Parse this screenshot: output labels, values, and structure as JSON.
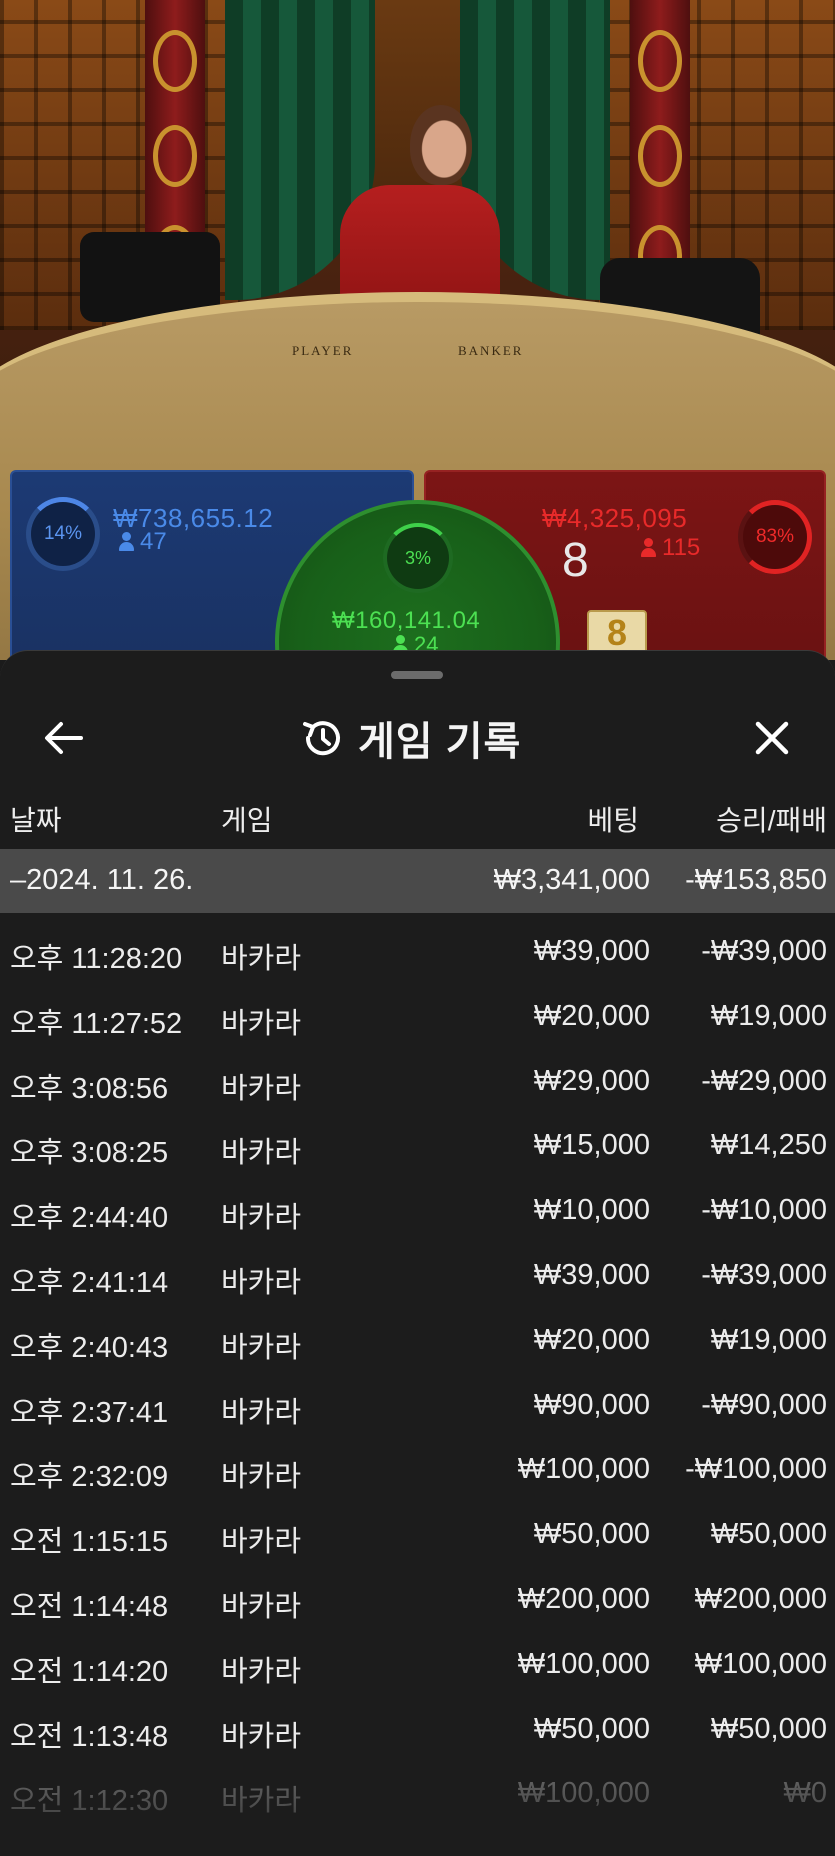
{
  "live_table": {
    "label_player": "PLAYER",
    "label_banker": "BANKER",
    "player": {
      "percent": "14%",
      "amount": "₩738,655.12",
      "bettors": "47"
    },
    "banker": {
      "percent": "83%",
      "amount": "₩4,325,095",
      "bettors": "115",
      "score": "8"
    },
    "tie": {
      "percent": "3%",
      "amount": "₩160,141.04",
      "bettors": "24"
    },
    "card_value": "8",
    "colors": {
      "player": "#4a8ae8",
      "banker": "#e82a2a",
      "tie": "#4ce052"
    }
  },
  "sheet": {
    "title": "게임 기록",
    "title_icon": "history-icon",
    "back_icon": "arrow-left-icon",
    "close_icon": "close-icon"
  },
  "columns": {
    "date": "날짜",
    "game": "게임",
    "bet": "베팅",
    "win_loss": "승리/패배"
  },
  "summary": {
    "date": "–2024. 11. 26.",
    "bet": "₩3,341,000",
    "win_loss": "-₩153,850"
  },
  "rows": [
    {
      "time": "오후 11:28:20",
      "game": "바카라",
      "bet": "₩39,000",
      "win_loss": "-₩39,000"
    },
    {
      "time": "오후 11:27:52",
      "game": "바카라",
      "bet": "₩20,000",
      "win_loss": "₩19,000"
    },
    {
      "time": "오후 3:08:56",
      "game": "바카라",
      "bet": "₩29,000",
      "win_loss": "-₩29,000"
    },
    {
      "time": "오후 3:08:25",
      "game": "바카라",
      "bet": "₩15,000",
      "win_loss": "₩14,250"
    },
    {
      "time": "오후 2:44:40",
      "game": "바카라",
      "bet": "₩10,000",
      "win_loss": "-₩10,000"
    },
    {
      "time": "오후 2:41:14",
      "game": "바카라",
      "bet": "₩39,000",
      "win_loss": "-₩39,000"
    },
    {
      "time": "오후 2:40:43",
      "game": "바카라",
      "bet": "₩20,000",
      "win_loss": "₩19,000"
    },
    {
      "time": "오후 2:37:41",
      "game": "바카라",
      "bet": "₩90,000",
      "win_loss": "-₩90,000"
    },
    {
      "time": "오후 2:32:09",
      "game": "바카라",
      "bet": "₩100,000",
      "win_loss": "-₩100,000"
    },
    {
      "time": "오전 1:15:15",
      "game": "바카라",
      "bet": "₩50,000",
      "win_loss": "₩50,000"
    },
    {
      "time": "오전 1:14:48",
      "game": "바카라",
      "bet": "₩200,000",
      "win_loss": "₩200,000"
    },
    {
      "time": "오전 1:14:20",
      "game": "바카라",
      "bet": "₩100,000",
      "win_loss": "₩100,000"
    },
    {
      "time": "오전 1:13:48",
      "game": "바카라",
      "bet": "₩50,000",
      "win_loss": "₩50,000"
    },
    {
      "time": "오전 1:12:30",
      "game": "바카라",
      "bet": "₩100,000",
      "win_loss": "₩0"
    }
  ]
}
